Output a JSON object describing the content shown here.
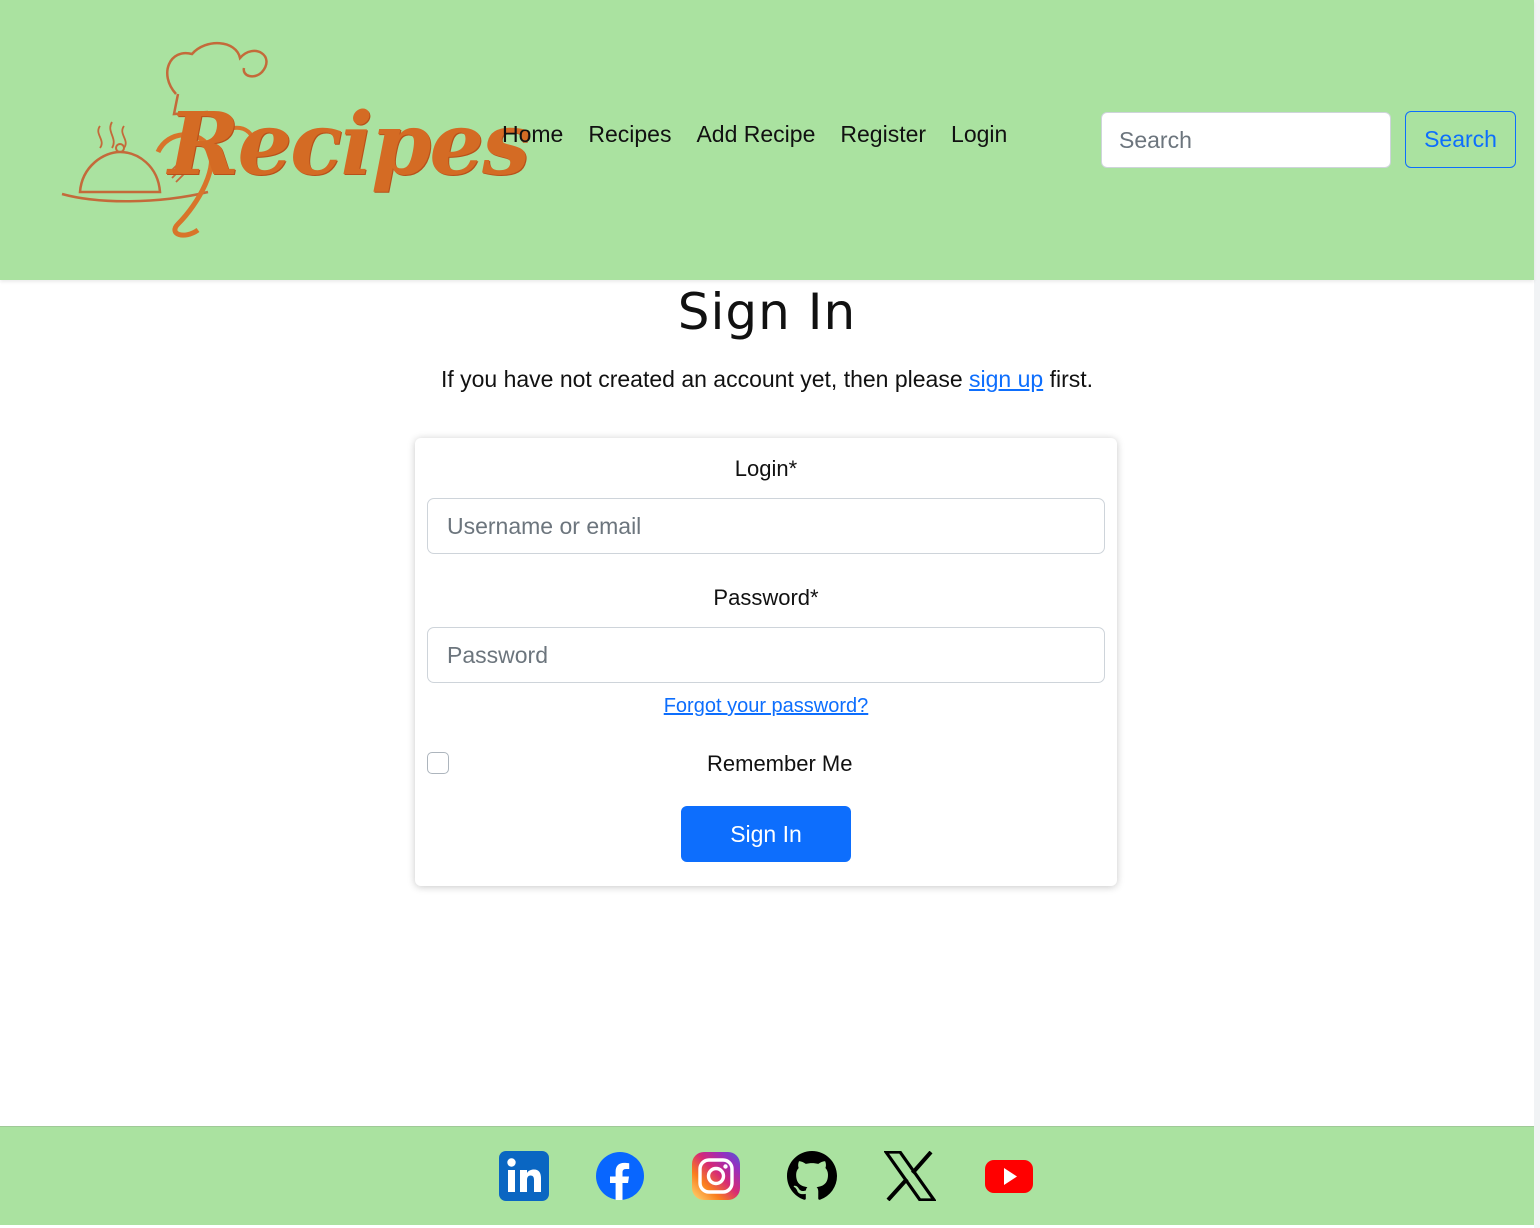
{
  "header": {
    "logo_text": "Recipes",
    "nav": [
      {
        "label": "Home"
      },
      {
        "label": "Recipes"
      },
      {
        "label": "Add Recipe"
      },
      {
        "label": "Register"
      },
      {
        "label": "Login"
      }
    ],
    "search": {
      "placeholder": "Search",
      "button_label": "Search"
    }
  },
  "main": {
    "title": "Sign In",
    "intro_before": "If you have not created an account yet, then please ",
    "intro_link": "sign up",
    "intro_after": " first.",
    "form": {
      "login_label": "Login*",
      "login_placeholder": "Username or email",
      "password_label": "Password*",
      "password_placeholder": "Password",
      "forgot_link": "Forgot your password?",
      "remember_label": "Remember Me",
      "remember_checked": false,
      "submit_label": "Sign In"
    }
  },
  "footer": {
    "social": [
      {
        "icon": "linkedin-icon",
        "color": "#0a66c2"
      },
      {
        "icon": "facebook-icon",
        "color": "#0866ff"
      },
      {
        "icon": "instagram-icon",
        "color": "#e1306c"
      },
      {
        "icon": "github-icon",
        "color": "#000000"
      },
      {
        "icon": "x-icon",
        "color": "#000000"
      },
      {
        "icon": "youtube-icon",
        "color": "#ff0000"
      }
    ]
  },
  "colors": {
    "header_bg": "#aae2a0",
    "primary": "#0d6efd",
    "logo_orange": "#d46b24"
  }
}
